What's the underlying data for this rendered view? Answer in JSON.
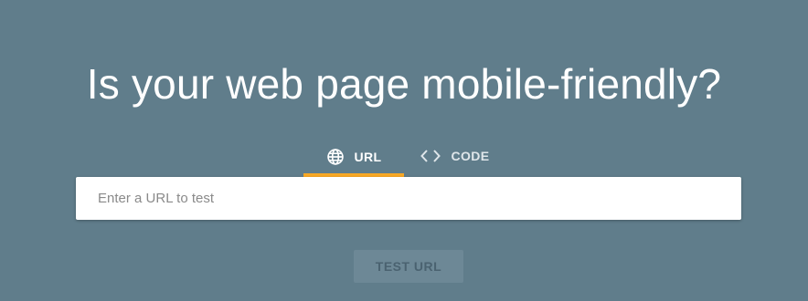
{
  "headline": "Is your web page mobile-friendly?",
  "tabs": [
    {
      "label": "URL",
      "icon": "globe-icon",
      "active": true
    },
    {
      "label": "CODE",
      "icon": "code-brackets-icon",
      "active": false
    }
  ],
  "url_input": {
    "placeholder": "Enter a URL to test",
    "value": ""
  },
  "test_button": {
    "label": "TEST URL",
    "enabled": false
  },
  "colors": {
    "background": "#607d8b",
    "tab_indicator": "#f9a825",
    "button_disabled_bg": "#6d8896",
    "button_disabled_text": "#4a6270"
  }
}
